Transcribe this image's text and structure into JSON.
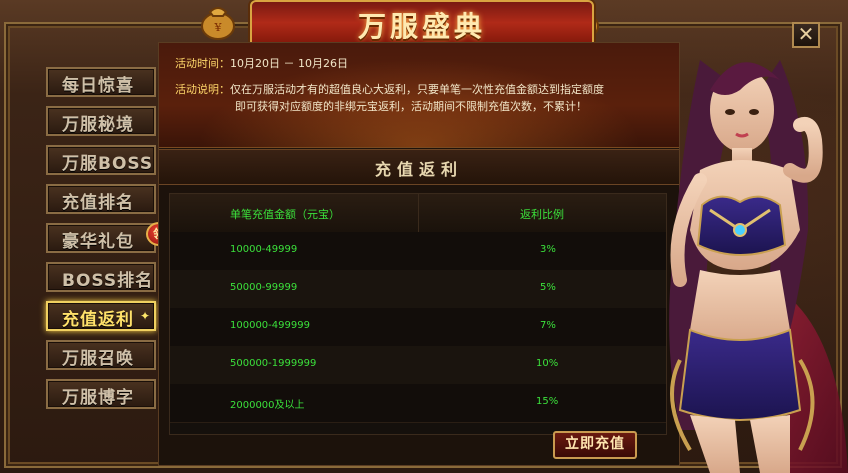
{
  "header": {
    "title": "万服盛典",
    "close_label": "✕"
  },
  "sidebar": {
    "items": [
      {
        "label": "每日惊喜"
      },
      {
        "label": "万服秘境"
      },
      {
        "label": "万服BOSS"
      },
      {
        "label": "充值排名"
      },
      {
        "label": "豪华礼包"
      },
      {
        "label": "BOSS排名"
      },
      {
        "label": "充值返利"
      },
      {
        "label": "万服召唤"
      },
      {
        "label": "万服博字"
      }
    ],
    "active_index": 6,
    "badge_text": "领"
  },
  "event": {
    "time_label": "活动时间：",
    "time_value": "10月20日 － 10月26日",
    "desc_label": "活动说明：",
    "desc_line1": "仅在万服活动才有的超值良心大返利，只要单笔一次性充值金额达到指定额度",
    "desc_line2": "即可获得对应额度的非绑元宝返利，活动期间不限制充值次数，不累计！"
  },
  "section": {
    "title": "充值返利"
  },
  "table": {
    "headers": [
      "单笔充值金额（元宝）",
      "返利比例"
    ],
    "rows": [
      [
        "10000-49999",
        "3%"
      ],
      [
        "50000-99999",
        "5%"
      ],
      [
        "100000-499999",
        "7%"
      ],
      [
        "500000-1999999",
        "10%"
      ],
      [
        "2000000及以上",
        "15%"
      ]
    ]
  },
  "actions": {
    "recharge_label": "立即充值"
  },
  "colors": {
    "accent_gold": "#d9a441",
    "table_text": "#3be03b",
    "active_tab": "#ffe16a"
  }
}
